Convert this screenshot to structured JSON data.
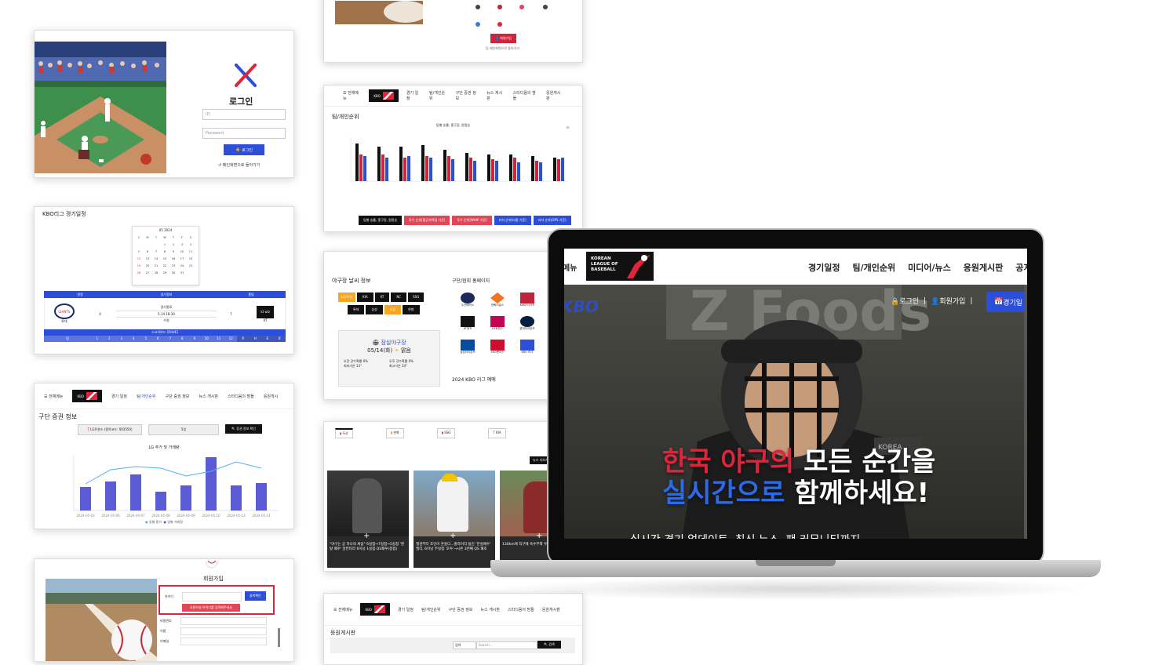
{
  "login_card": {
    "title": "로그인",
    "id_placeholder": "ID",
    "password_placeholder": "Password",
    "login_button": "로그인",
    "back_link": "메인화면으로 돌아가기"
  },
  "schedule_card": {
    "title": "KBO리그 경기일정",
    "calendar_month": "05 2024",
    "weekdays": [
      "S",
      "M",
      "T",
      "W",
      "T",
      "F",
      "S"
    ],
    "table_headers": [
      "원정",
      "경기정보",
      "홈팀"
    ],
    "game_label": "경기종료",
    "datetime": "5.14 18:30",
    "venue": "수원",
    "away_team": "롯데",
    "away_score": "4",
    "home_team": "KT",
    "home_score": "7",
    "scoreboard_title": "스코어보드 [R/H/E]",
    "innings": [
      "팀",
      "1",
      "2",
      "3",
      "4",
      "5",
      "6",
      "7",
      "8",
      "9",
      "10",
      "11",
      "12",
      "R",
      "H",
      "E",
      "B"
    ]
  },
  "stock_card": {
    "menu": "전체메뉴",
    "nav": [
      "경기 일정",
      "팀/개인순위",
      "구단 증권 정보",
      "뉴스 게시판",
      "스타디움의 밤들",
      "응원게시"
    ],
    "title": "구단 증권 정보",
    "company": "LG트윈스 (종목코드: 003550)",
    "period": "5일",
    "search_button": "증권 정보 확인",
    "chart_title": "LG 주가 및 거래량",
    "legend": [
      "일별 종가",
      "일별 거래량"
    ]
  },
  "signup_card": {
    "title": "회원가입",
    "id_label": "아이디",
    "dup_button": "중복확인",
    "warning": "사용하실 아이디를 입력해주세요",
    "labels": [
      "비밀번호",
      "이름",
      "이메일"
    ]
  },
  "top_card": {
    "button": "회원가입",
    "link": "팀 메인화면으로 돌아가기"
  },
  "ranking_card": {
    "menu": "전체메뉴",
    "nav": [
      "경기 일정",
      "팀/개인순위",
      "구단 증권 정보",
      "뉴스 게시판",
      "스타디움의 밤들",
      "응원게시판"
    ],
    "title": "팀/개인순위",
    "chart_title": "팀별 승률, 홈구장, 원정승",
    "buttons": [
      "팀별 승률, 홈구장, 원정승",
      "투수 순위(평균자책점 기준)",
      "투수 순위(WHIP 기준)",
      "타자 순위(타율 기준)",
      "타자 순위(OPS 기준)"
    ]
  },
  "weather_card": {
    "title": "야구장 날씨 정보",
    "teams_row1": [
      "LG/두산",
      "KIA",
      "KT",
      "NC",
      "SSG"
    ],
    "teams_row2": [
      "롯데",
      "삼성",
      "키움",
      "한화"
    ],
    "stadium": "잠실야구장",
    "date": "05/14(화)",
    "condition": "맑음",
    "stats": [
      "오전 강수확률 0%",
      "오후 강수확률 0%",
      "최저기온 13°",
      "최고기온 24°"
    ],
    "homepage_title": "구단/협회 홈페이지",
    "teams": [
      "두산베어스",
      "한화이글스",
      "KIA타이거즈",
      "KT위즈",
      "LG트윈스",
      "롯데자이언츠",
      "삼성라이온즈",
      "SSG랜더스",
      "KBO 리그"
    ],
    "footer": "2024 KBO 리그 예매"
  },
  "news_card": {
    "tabs": [
      "두산",
      "한화",
      "SSG",
      "KIA"
    ],
    "more": "뉴스 더보기",
    "captions": [
      "\"야구는 공 하나의 싸움\" 6실점→7실점→5실점 '멘탈 폐수' 알칸타라 6이닝 1실점 QS쾌투(종합)",
      "엘검부터 조인이 흔들다...줄라이더 들인 '한실패수' 엘리, 6이닝 무실점 '호투'→시즌 3번째 QS 쾌조",
      "130km에 직구에 속수무책 우일협, 데뷔 첫 선발승"
    ]
  },
  "board_card": {
    "menu": "전체메뉴",
    "nav": [
      "경기 일정",
      "팀/개인순위",
      "구단 증권 정보",
      "뉴스 게시판",
      "스타디움의 밤들",
      "응원게시판"
    ],
    "title": "응원게시판",
    "select": "검색",
    "search_placeholder": "Search...",
    "search_button": "검색"
  },
  "laptop": {
    "menu": "메뉴",
    "logo_lines": [
      "KOREAN",
      "LEAGUE OF",
      "BASEBALL"
    ],
    "nav": [
      "경기일정",
      "팀/개인순위",
      "미디어/뉴스",
      "응원게시판",
      "공지"
    ],
    "login": "로그인",
    "signup": "회원가입",
    "schedule_button": "경기일",
    "kbo": "KBO",
    "hero_red_1": "한국 야구의",
    "hero_white_1": " 모든 순간을",
    "hero_blue_2": "실시간으로",
    "hero_white_2": " 함께하세요!",
    "hero_sub": "실시간 경기 업데이트, 최신 뉴스, 팬 커뮤니티까지"
  },
  "colors": {
    "red": "#e0243c",
    "blue": "#2c4ed8",
    "dark": "#111111"
  }
}
